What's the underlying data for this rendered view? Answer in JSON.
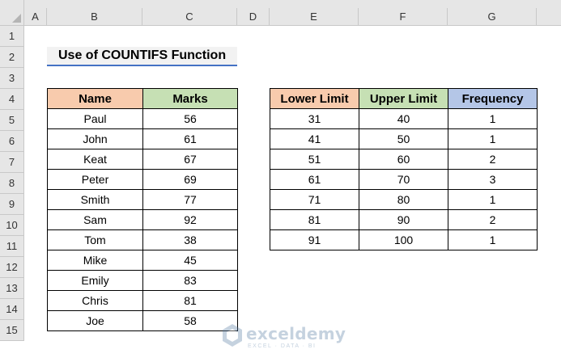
{
  "columns": [
    "A",
    "B",
    "C",
    "D",
    "E",
    "F",
    "G"
  ],
  "rows": [
    "1",
    "2",
    "3",
    "4",
    "5",
    "6",
    "7",
    "8",
    "9",
    "10",
    "11",
    "12",
    "13",
    "14",
    "15"
  ],
  "title": "Use of COUNTIFS Function",
  "marks_table": {
    "headers": {
      "name": "Name",
      "marks": "Marks"
    },
    "rows": [
      {
        "name": "Paul",
        "marks": "56"
      },
      {
        "name": "John",
        "marks": "61"
      },
      {
        "name": "Keat",
        "marks": "67"
      },
      {
        "name": "Peter",
        "marks": "69"
      },
      {
        "name": "Smith",
        "marks": "77"
      },
      {
        "name": "Sam",
        "marks": "92"
      },
      {
        "name": "Tom",
        "marks": "38"
      },
      {
        "name": "Mike",
        "marks": "45"
      },
      {
        "name": "Emily",
        "marks": "83"
      },
      {
        "name": "Chris",
        "marks": "81"
      },
      {
        "name": "Joe",
        "marks": "58"
      }
    ]
  },
  "frequency_table": {
    "headers": {
      "lower": "Lower Limit",
      "upper": "Upper Limit",
      "frequency": "Frequency"
    },
    "rows": [
      {
        "lower": "31",
        "upper": "40",
        "frequency": "1"
      },
      {
        "lower": "41",
        "upper": "50",
        "frequency": "1"
      },
      {
        "lower": "51",
        "upper": "60",
        "frequency": "2"
      },
      {
        "lower": "61",
        "upper": "70",
        "frequency": "3"
      },
      {
        "lower": "71",
        "upper": "80",
        "frequency": "1"
      },
      {
        "lower": "81",
        "upper": "90",
        "frequency": "2"
      },
      {
        "lower": "91",
        "upper": "100",
        "frequency": "1"
      }
    ]
  },
  "watermark": {
    "name": "exceldemy",
    "tagline": "EXCEL · DATA · BI"
  },
  "colors": {
    "header_orange": "#f8cbad",
    "header_green": "#c6e0b4",
    "header_blue": "#b4c6e7",
    "title_underline": "#4472c4"
  }
}
